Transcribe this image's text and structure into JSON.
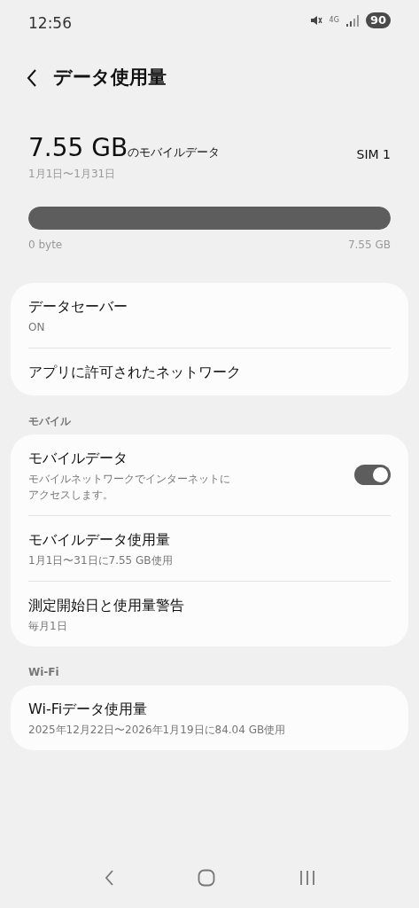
{
  "status_bar": {
    "time": "12:56",
    "network": "4G",
    "battery": "90"
  },
  "header": {
    "title": "データ使用量"
  },
  "usage": {
    "amount": "7.55 GB",
    "amount_suffix": "のモバイルデータ",
    "period": "1月1日〜1月31日",
    "sim": "SIM 1",
    "level": 1.0,
    "min_label": "0 byte",
    "max_label": "7.55 GB"
  },
  "sections": [
    {
      "items": [
        {
          "kind": "link",
          "title": "データセーバー",
          "subtitle": "ON"
        },
        {
          "kind": "link",
          "title": "アプリに許可されたネットワーク"
        }
      ]
    },
    {
      "header": "モバイル",
      "items": [
        {
          "kind": "toggle",
          "title": "モバイルデータ",
          "subtitle": "モバイルネットワークでインターネットにアクセスします。",
          "on": true
        },
        {
          "kind": "link",
          "title": "モバイルデータ使用量",
          "subtitle": "1月1日〜31日に7.55 GB使用"
        },
        {
          "kind": "link",
          "title": "測定開始日と使用量警告",
          "subtitle": "毎月1日"
        }
      ]
    },
    {
      "header": "Wi-Fi",
      "items": [
        {
          "kind": "link",
          "title": "Wi-Fiデータ使用量",
          "subtitle": "2025年12月22日〜2026年1月19日に84.04 GB使用"
        }
      ]
    }
  ]
}
